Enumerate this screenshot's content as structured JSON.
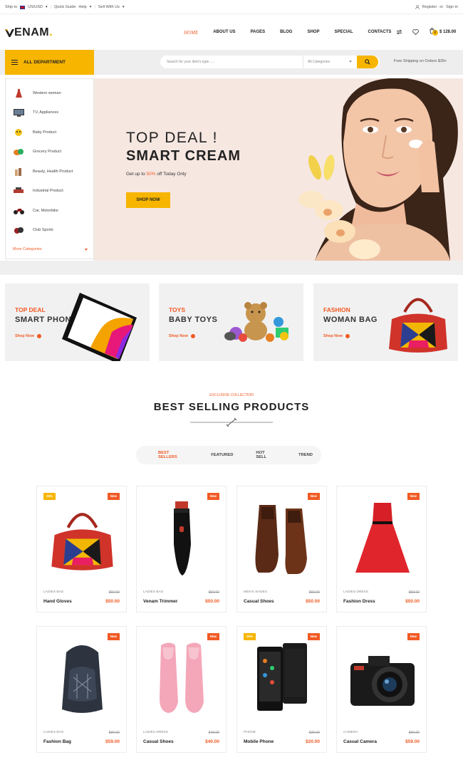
{
  "topbar": {
    "ship_to": "Ship to",
    "currency": "US/USD",
    "quick_guide": "Quick Guide",
    "help": "Help",
    "sell_with_us": "Sell With Us",
    "register": "Register",
    "or": "or",
    "sign_in": "Sign in"
  },
  "header": {
    "logo": "ENAM",
    "nav": [
      "HOME",
      "ABOUT US",
      "PAGES",
      "BLOG",
      "SHOP",
      "SPECIAL",
      "CONTACTS"
    ],
    "cart_count": "0",
    "cart_total": "$ 128.00"
  },
  "category_bar": {
    "all_department": "ALL DEPARTMENT",
    "search_placeholder": "Search for your item's type .....",
    "category_select": "All Categories",
    "free_shipping": "Free Shipping on Orders $39+"
  },
  "sidebar": {
    "items": [
      {
        "label": "Western woman"
      },
      {
        "label": "TV, Appliances"
      },
      {
        "label": "Baby Product"
      },
      {
        "label": "Grocery Product"
      },
      {
        "label": "Beauty, Health Product"
      },
      {
        "label": "Industrial Product"
      },
      {
        "label": "Car, Motorbike"
      },
      {
        "label": "Club Sports"
      }
    ],
    "more": "More Categories"
  },
  "hero": {
    "line1": "TOP DEAL !",
    "line2": "SMART CREAM",
    "sub_prefix": "Get up to ",
    "sub_highlight": "50%",
    "sub_suffix": " off Today Only",
    "button": "SHOP NOW"
  },
  "promos": [
    {
      "kicker": "TOP DEAL",
      "name": "SMART PHONE",
      "link": "Shop Now"
    },
    {
      "kicker": "TOYS",
      "name": "BABY TOYS",
      "link": "Shop Now"
    },
    {
      "kicker": "FASHION",
      "name": "WOMAN BAG",
      "link": "Shop Now"
    }
  ],
  "section": {
    "subtitle": "EXCLUSIVE COLLECTION",
    "title": "BEST SELLING PRODUCTS",
    "tabs": [
      "BEST SELLERS",
      "FEATURED",
      "HOT SELL",
      "TREND"
    ]
  },
  "products": [
    {
      "category": "LADIES BAG",
      "name": "Hand Gloves",
      "old_price": "$69.00",
      "price": "$50.00",
      "sale": "25%",
      "new": "New"
    },
    {
      "category": "LADIES BAG",
      "name": "Venam Trimmer",
      "old_price": "$69.00",
      "price": "$50.00",
      "sale": "",
      "new": "New"
    },
    {
      "category": "MEN'S SHOES",
      "name": "Casual Shoes",
      "old_price": "$69.00",
      "price": "$50.00",
      "sale": "",
      "new": "New"
    },
    {
      "category": "LADIES DRESS",
      "name": "Fashion Dress",
      "old_price": "$69.00",
      "price": "$50.00",
      "sale": "",
      "new": "New"
    },
    {
      "category": "LADIES BAG",
      "name": "Fashion Bag",
      "old_price": "$99.00",
      "price": "$59.00",
      "sale": "",
      "new": "New"
    },
    {
      "category": "LADIES DRESS",
      "name": "Casual Shoes",
      "old_price": "$49.00",
      "price": "$40.00",
      "sale": "",
      "new": "New"
    },
    {
      "category": "PHONE",
      "name": "Mobile Phone",
      "old_price": "$29.00",
      "price": "$20.00",
      "sale": "25%",
      "new": "New"
    },
    {
      "category": "CAMERA",
      "name": "Casual Camera",
      "old_price": "$69.00",
      "price": "$59.00",
      "sale": "",
      "new": "New"
    }
  ],
  "colors": {
    "accent": "#f7b500",
    "highlight": "#f15a24"
  }
}
